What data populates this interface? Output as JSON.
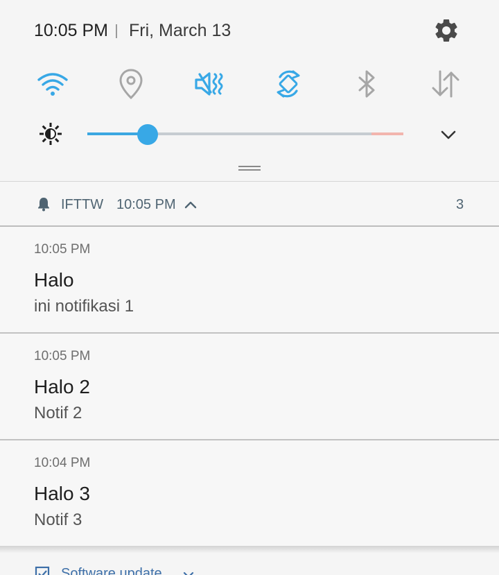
{
  "status": {
    "time": "10:05 PM",
    "date": "Fri, March 13",
    "settings_icon": "gear-icon"
  },
  "quick_settings": [
    {
      "icon": "wifi-icon",
      "active": true
    },
    {
      "icon": "location-icon",
      "active": false
    },
    {
      "icon": "sound-mute-icon",
      "active": true
    },
    {
      "icon": "auto-rotate-icon",
      "active": true
    },
    {
      "icon": "bluetooth-icon",
      "active": false
    },
    {
      "icon": "mobile-data-icon",
      "active": false
    }
  ],
  "brightness": {
    "icon": "brightness-icon",
    "level": 0.19,
    "expand_icon": "chevron-down-icon"
  },
  "notification_group": {
    "app_name": "IFTTW",
    "time": "10:05 PM",
    "count": "3"
  },
  "notifications": [
    {
      "time": "10:05 PM",
      "title": "Halo",
      "body": "ini notifikasi 1"
    },
    {
      "time": "10:05 PM",
      "title": "Halo 2",
      "body": "Notif 2"
    },
    {
      "time": "10:04 PM",
      "title": "Halo 3",
      "body": "Notif 3"
    }
  ],
  "next_group": {
    "label": "Software update"
  },
  "colors": {
    "accent": "#38a8e6",
    "inactive_icon": "#a6a6a6",
    "secondary_text": "#4f6472"
  }
}
